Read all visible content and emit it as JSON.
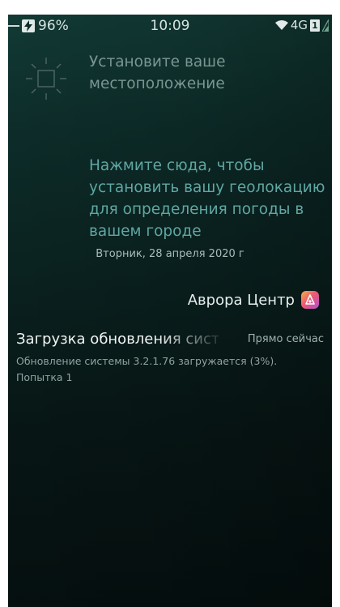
{
  "status_bar": {
    "battery": "96%",
    "time": "10:09",
    "network": "4G",
    "sim": "1"
  },
  "weather": {
    "title": "Установите ваше местоположение",
    "hint": "Нажмите сюда, чтобы установить вашу геолокацию для определения погоды в вашем городе"
  },
  "date": "Вторник, 28 апреля 2020 г",
  "notification_group": {
    "app_name": "Аврора Центр",
    "app_icon": "aurora-center-icon",
    "items": [
      {
        "title": "Загрузка обновления системы",
        "time": "Прямо сейчас",
        "body": "Обновление системы 3.2.1.76 загружается (3%). Попытка 1"
      }
    ]
  },
  "colors": {
    "background_top": "#123a35",
    "background_bottom": "#050f0f",
    "hint_accent": "#5fa7a2"
  }
}
